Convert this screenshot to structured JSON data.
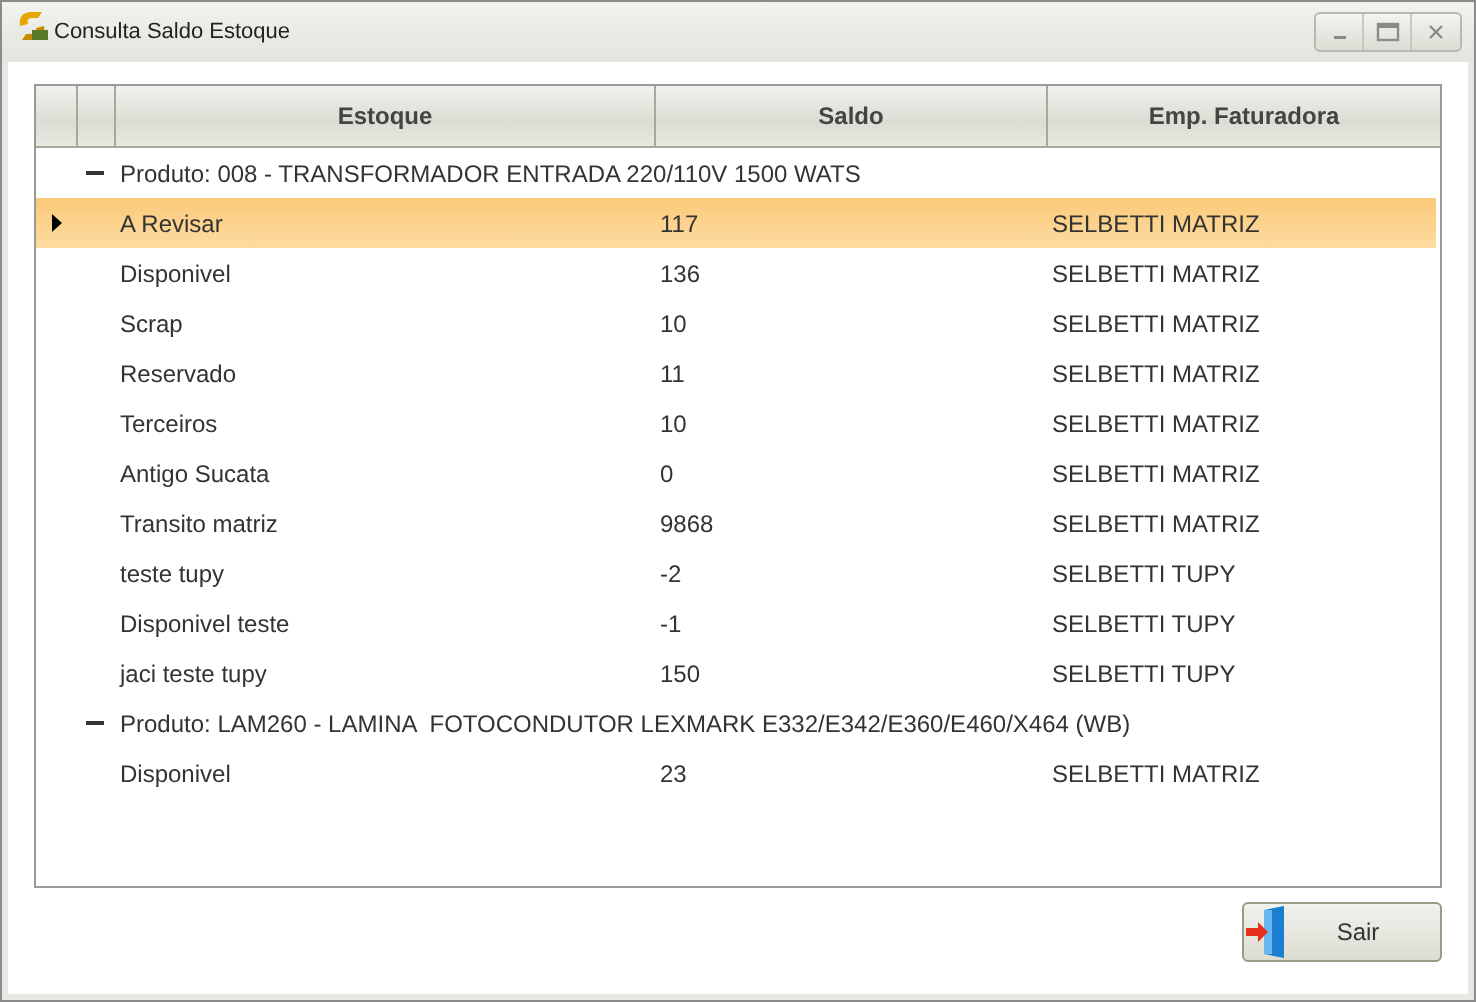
{
  "window": {
    "title": "Consulta Saldo Estoque"
  },
  "table": {
    "columns": [
      "Estoque",
      "Saldo",
      "Emp. Faturadora"
    ],
    "groups": [
      {
        "label": "Produto: 008 - TRANSFORMADOR ENTRADA 220/110V 1500 WATS",
        "expanded": true,
        "rows": [
          {
            "cells": [
              "A Revisar",
              "117",
              "SELBETTI MATRIZ"
            ],
            "selected": true
          },
          {
            "cells": [
              "Disponivel",
              "136",
              "SELBETTI MATRIZ"
            ],
            "selected": false
          },
          {
            "cells": [
              "Scrap",
              "10",
              "SELBETTI MATRIZ"
            ],
            "selected": false
          },
          {
            "cells": [
              "Reservado",
              "11",
              "SELBETTI MATRIZ"
            ],
            "selected": false
          },
          {
            "cells": [
              "Terceiros",
              "10",
              "SELBETTI MATRIZ"
            ],
            "selected": false
          },
          {
            "cells": [
              "Antigo Sucata",
              "0",
              "SELBETTI MATRIZ"
            ],
            "selected": false
          },
          {
            "cells": [
              "Transito matriz",
              "9868",
              "SELBETTI MATRIZ"
            ],
            "selected": false
          },
          {
            "cells": [
              "teste tupy",
              "-2",
              "SELBETTI TUPY"
            ],
            "selected": false
          },
          {
            "cells": [
              "Disponivel teste",
              "-1",
              "SELBETTI TUPY"
            ],
            "selected": false
          },
          {
            "cells": [
              "jaci teste tupy",
              "150",
              "SELBETTI TUPY"
            ],
            "selected": false
          }
        ]
      },
      {
        "label": "Produto: LAM260 - LAMINA  FOTOCONDUTOR LEXMARK E332/E342/E360/E460/X464 (WB)",
        "expanded": true,
        "rows": [
          {
            "cells": [
              "Disponivel",
              "23",
              "SELBETTI MATRIZ"
            ],
            "selected": false
          }
        ]
      }
    ]
  },
  "buttons": [
    {
      "label": "Sair"
    }
  ]
}
